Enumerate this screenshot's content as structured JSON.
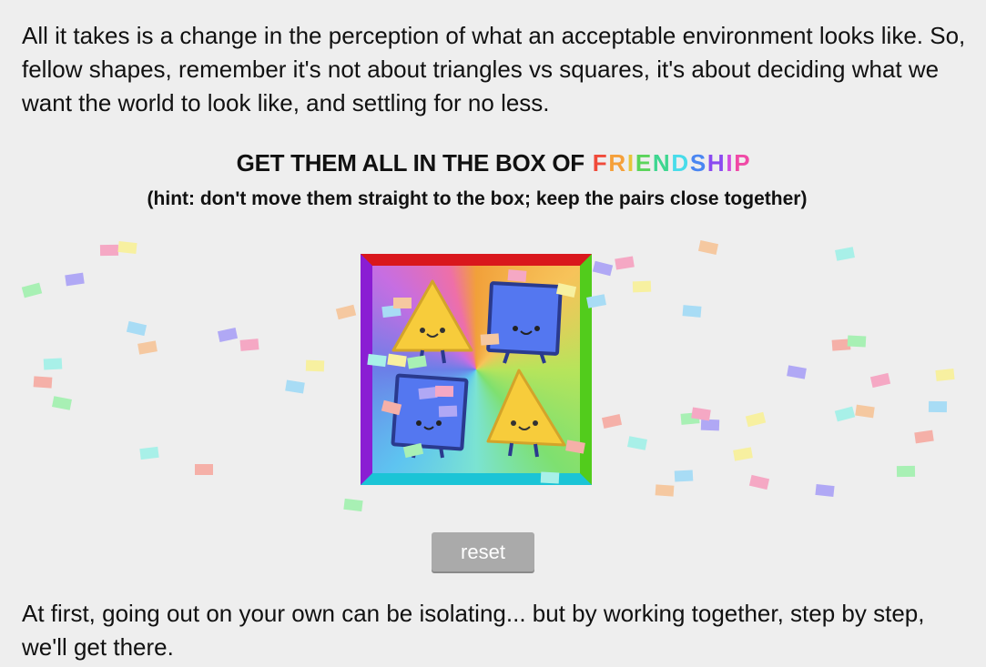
{
  "intro_text": "All it takes is a change in the perception of what an acceptable environment looks like. So, fellow shapes, remember it's not about triangles vs squares, it's about deciding what we want the world to look like, and settling for no less.",
  "title_prefix": "GET THEM ALL IN THE BOX OF",
  "friendship_letters": [
    {
      "char": "F",
      "color": "#f04a3a"
    },
    {
      "char": "R",
      "color": "#f5a03a"
    },
    {
      "char": "I",
      "color": "#e8c43a"
    },
    {
      "char": "E",
      "color": "#5ad45a"
    },
    {
      "char": "N",
      "color": "#3ed690"
    },
    {
      "char": "D",
      "color": "#48dcea"
    },
    {
      "char": "S",
      "color": "#4a86f2"
    },
    {
      "char": "H",
      "color": "#8a4af0"
    },
    {
      "char": "I",
      "color": "#d04ae0"
    },
    {
      "char": "P",
      "color": "#f04aa6"
    }
  ],
  "hint_text": "(hint: don't move them straight to the box; keep the pairs close together)",
  "reset_label": "reset",
  "outro_text": "At first, going out on your own can be isolating... but by working together, step by step, we'll get there.",
  "shape_colors": {
    "triangle": "#f7cc3b",
    "square": "#5477f0",
    "outline": "#2a3a8e"
  }
}
